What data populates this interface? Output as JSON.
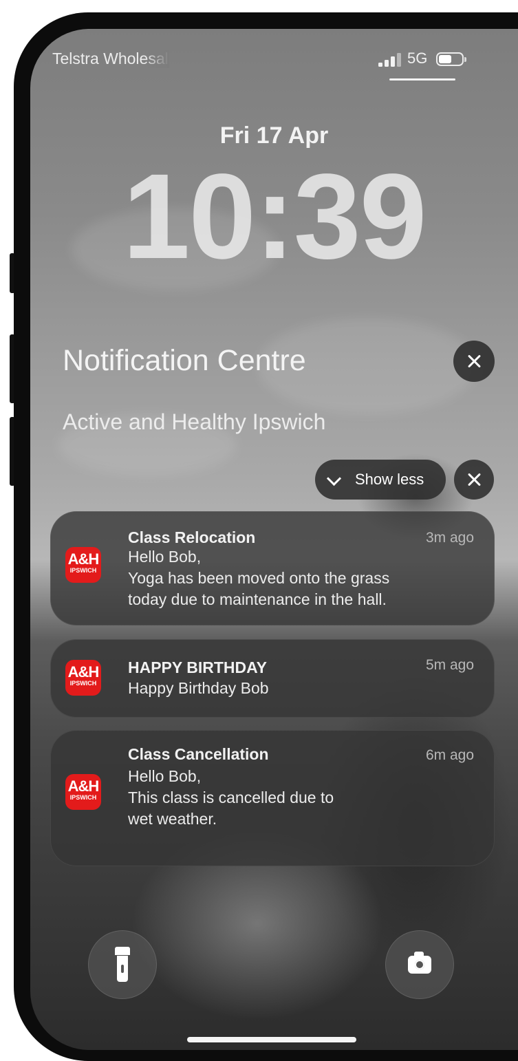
{
  "status_bar": {
    "carrier": "Telstra Wholesale",
    "network": "5G",
    "signal_bars": 3,
    "signal_bars_total": 4,
    "battery_icon": "battery-icon"
  },
  "lock_screen": {
    "date": "Fri 17 Apr",
    "time": "10:39"
  },
  "notification_centre": {
    "title": "Notification Centre",
    "clear_icon": "close-icon"
  },
  "app_group": {
    "name": "Active and Healthy Ipswich",
    "show_less_label": "Show less",
    "chevron_icon": "chevron-down-icon",
    "clear_icon": "close-icon"
  },
  "app_icon": {
    "text_large": "A&H",
    "text_small": "IPSWICH",
    "color": "#e31b1b"
  },
  "notifications": [
    {
      "title": "Class Relocation",
      "time": "3m ago",
      "lines": [
        "Hello Bob,",
        "Yoga has been moved onto the grass",
        "today due to maintenance in the hall."
      ]
    },
    {
      "title": "HAPPY BIRTHDAY",
      "time": "5m ago",
      "lines": [
        "Happy Birthday Bob"
      ]
    },
    {
      "title": "Class Cancellation",
      "time": "6m ago",
      "lines": [
        "Hello Bob,",
        "This class is cancelled due to",
        "wet weather."
      ]
    }
  ],
  "quick_actions": {
    "left_icon": "flashlight-icon",
    "right_icon": "camera-icon"
  }
}
